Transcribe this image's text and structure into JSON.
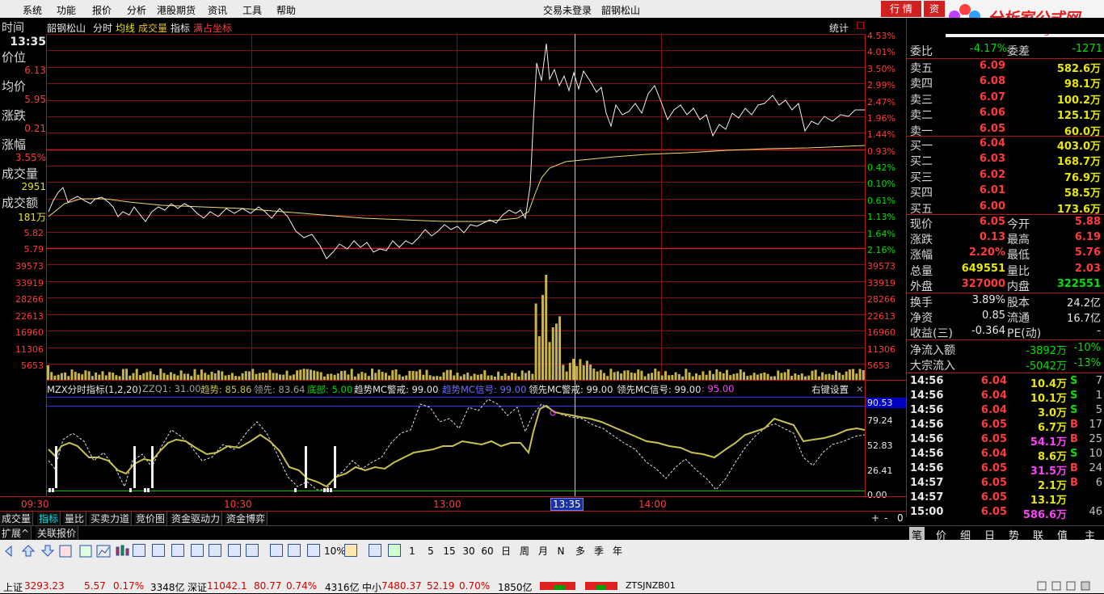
{
  "menu": {
    "items": [
      "系统",
      "功能",
      "报价",
      "分析",
      "港股期货",
      "资讯",
      "工具",
      "帮助"
    ],
    "center1": "交易未登录",
    "center2": "韶钢松山",
    "btn_quote": "行 情",
    "btn_2": "资",
    "logo_text": "分析家公式网",
    "logo_url": "www.88gs.com"
  },
  "chart_header": {
    "time_label": "时间",
    "stock": "韶钢松山",
    "tab_fenshi": "分时",
    "tab_junxian": "均线",
    "tab_volume": "成交量",
    "tab_indicator": "指标",
    "tab_coord": "满占坐标",
    "stats": "统计"
  },
  "info_panel": {
    "time_value": "13:35",
    "price_label": "价位",
    "price": "6.13",
    "avg_label": "均价",
    "avg": "5.95",
    "chg_label": "涨跌",
    "chg": "0.21",
    "pct_label": "涨幅",
    "pct": "3.55%",
    "vol_label": "成交量",
    "vol": "2951",
    "amt_label": "成交额",
    "amt": "181万"
  },
  "price_axis_left": [
    "5.82",
    "5.79"
  ],
  "price_axis_right": [
    "4.53%",
    "4.01%",
    "3.50%",
    "2.99%",
    "2.47%",
    "1.96%",
    "1.44%",
    "0.93%",
    "0.42%",
    "0.10%",
    "0.61%",
    "1.13%",
    "1.64%",
    "2.16%"
  ],
  "volume_axis": [
    "39573",
    "33919",
    "28266",
    "22613",
    "16960",
    "11306",
    "5653"
  ],
  "indicator": {
    "name": "MZX分时指标(1,2,20)",
    "zzq": "ZZQ1: 31.00",
    "trend": "趋势: 85.86",
    "lead": "领先: 83.64",
    "bottom": "底部: 5.00",
    "trend_mc_warn": "趋势MC警戒: 99.00",
    "trend_mc_sig": "趋势MC信号: 99.00",
    "lead_mc_warn": "领先MC警戒: 99.00",
    "lead_mc_sig": "领先MC信号: 99.00",
    "last": ": 95.00",
    "settings": "右键设置",
    "close": "×",
    "axis": [
      "90.53",
      "79.24",
      "52.83",
      "26.41",
      "0.00"
    ]
  },
  "time_axis": [
    "09:30",
    "10:30",
    "13:00",
    "13:35",
    "14:00"
  ],
  "quote": {
    "weibi_label": "委比",
    "weibi": "-4.17%",
    "weicha_label": "委差",
    "weicha": "-1271",
    "asks": [
      {
        "label": "卖五",
        "price": "6.09",
        "vol": "582.6万"
      },
      {
        "label": "卖四",
        "price": "6.08",
        "vol": "98.1万"
      },
      {
        "label": "卖三",
        "price": "6.07",
        "vol": "100.2万"
      },
      {
        "label": "卖二",
        "price": "6.06",
        "vol": "125.1万"
      },
      {
        "label": "卖一",
        "price": "6.05",
        "vol": "60.0万"
      }
    ],
    "bids": [
      {
        "label": "买一",
        "price": "6.04",
        "vol": "403.0万"
      },
      {
        "label": "买二",
        "price": "6.03",
        "vol": "168.7万"
      },
      {
        "label": "买三",
        "price": "6.02",
        "vol": "76.9万"
      },
      {
        "label": "买四",
        "price": "6.01",
        "vol": "58.5万"
      },
      {
        "label": "买五",
        "price": "6.00",
        "vol": "173.6万"
      }
    ],
    "stats": [
      {
        "l1": "现价",
        "v1": "6.05",
        "l2": "今开",
        "v2": "5.88"
      },
      {
        "l1": "涨跌",
        "v1": "0.13",
        "l2": "最高",
        "v2": "6.19"
      },
      {
        "l1": "涨幅",
        "v1": "2.20%",
        "l2": "最低",
        "v2": "5.76"
      },
      {
        "l1": "总量",
        "v1": "649551",
        "l2": "量比",
        "v2": "2.03"
      },
      {
        "l1": "外盘",
        "v1": "327000",
        "l2": "内盘",
        "v2": "322551"
      }
    ],
    "stats2": [
      {
        "l1": "换手",
        "v1": "3.89%",
        "l2": "股本",
        "v2": "24.2亿"
      },
      {
        "l1": "净资",
        "v1": "0.85",
        "l2": "流通",
        "v2": "16.7亿"
      },
      {
        "l1": "收益(三)",
        "v1": "-0.364",
        "l2": "PE(动)",
        "v2": "-"
      }
    ],
    "flow": [
      {
        "label": "净流入额",
        "v1": "-3892万",
        "v2": "-10%"
      },
      {
        "label": "大宗流入",
        "v1": "-5042万",
        "v2": "-13%"
      }
    ]
  },
  "ticks": [
    {
      "t": "14:56",
      "p": "6.04",
      "v": "10.4万",
      "s": "S",
      "n": "7"
    },
    {
      "t": "14:56",
      "p": "6.04",
      "v": "10.1万",
      "s": "S",
      "n": "1"
    },
    {
      "t": "14:56",
      "p": "6.04",
      "v": "3.0万",
      "s": "S",
      "n": "5"
    },
    {
      "t": "14:56",
      "p": "6.05",
      "v": "6.7万",
      "s": "B",
      "n": "17"
    },
    {
      "t": "14:56",
      "p": "6.05",
      "v": "54.1万",
      "s": "B",
      "n": "25"
    },
    {
      "t": "14:56",
      "p": "6.04",
      "v": "8.6万",
      "s": "S",
      "n": "10"
    },
    {
      "t": "14:56",
      "p": "6.05",
      "v": "31.5万",
      "s": "B",
      "n": "24"
    },
    {
      "t": "14:57",
      "p": "6.05",
      "v": "2.1万",
      "s": "B",
      "n": "6"
    },
    {
      "t": "14:57",
      "p": "6.05",
      "v": "13.1万",
      "s": "",
      "n": ""
    },
    {
      "t": "15:00",
      "p": "6.05",
      "v": "586.6万",
      "s": "",
      "n": "46"
    }
  ],
  "right_tabs": [
    "笔",
    "价",
    "细",
    "日",
    "势",
    "联",
    "值",
    "主"
  ],
  "bottom_tabs": [
    "成交量",
    "指标",
    "量比",
    "买卖力道",
    "竞价图",
    "资金驱动力",
    "资金博弈"
  ],
  "bottom_controls": [
    "+",
    "-",
    "0"
  ],
  "tabs2": [
    "扩展^",
    "关联报价"
  ],
  "toolbar_periods": [
    "1",
    "5",
    "15",
    "30",
    "60",
    "日",
    "周",
    "月",
    "N",
    "多",
    "季",
    "年"
  ],
  "toolbar_pct": "10%",
  "status": {
    "sh_label": "上证",
    "sh_val": "3293.23",
    "sh_chg": "5.57",
    "sh_pct": "0.17%",
    "sh_amt": "3348亿",
    "sz_label": "深证",
    "sz_val": "11042.1",
    "sz_chg": "80.77",
    "sz_pct": "0.74%",
    "sz_amt": "4316亿",
    "zx_label": "中小",
    "zx_val": "7480.37",
    "zx_chg": "52.19",
    "zx_pct": "0.70%",
    "zx_amt": "1850亿",
    "code": "ZTSJNZB01"
  }
}
